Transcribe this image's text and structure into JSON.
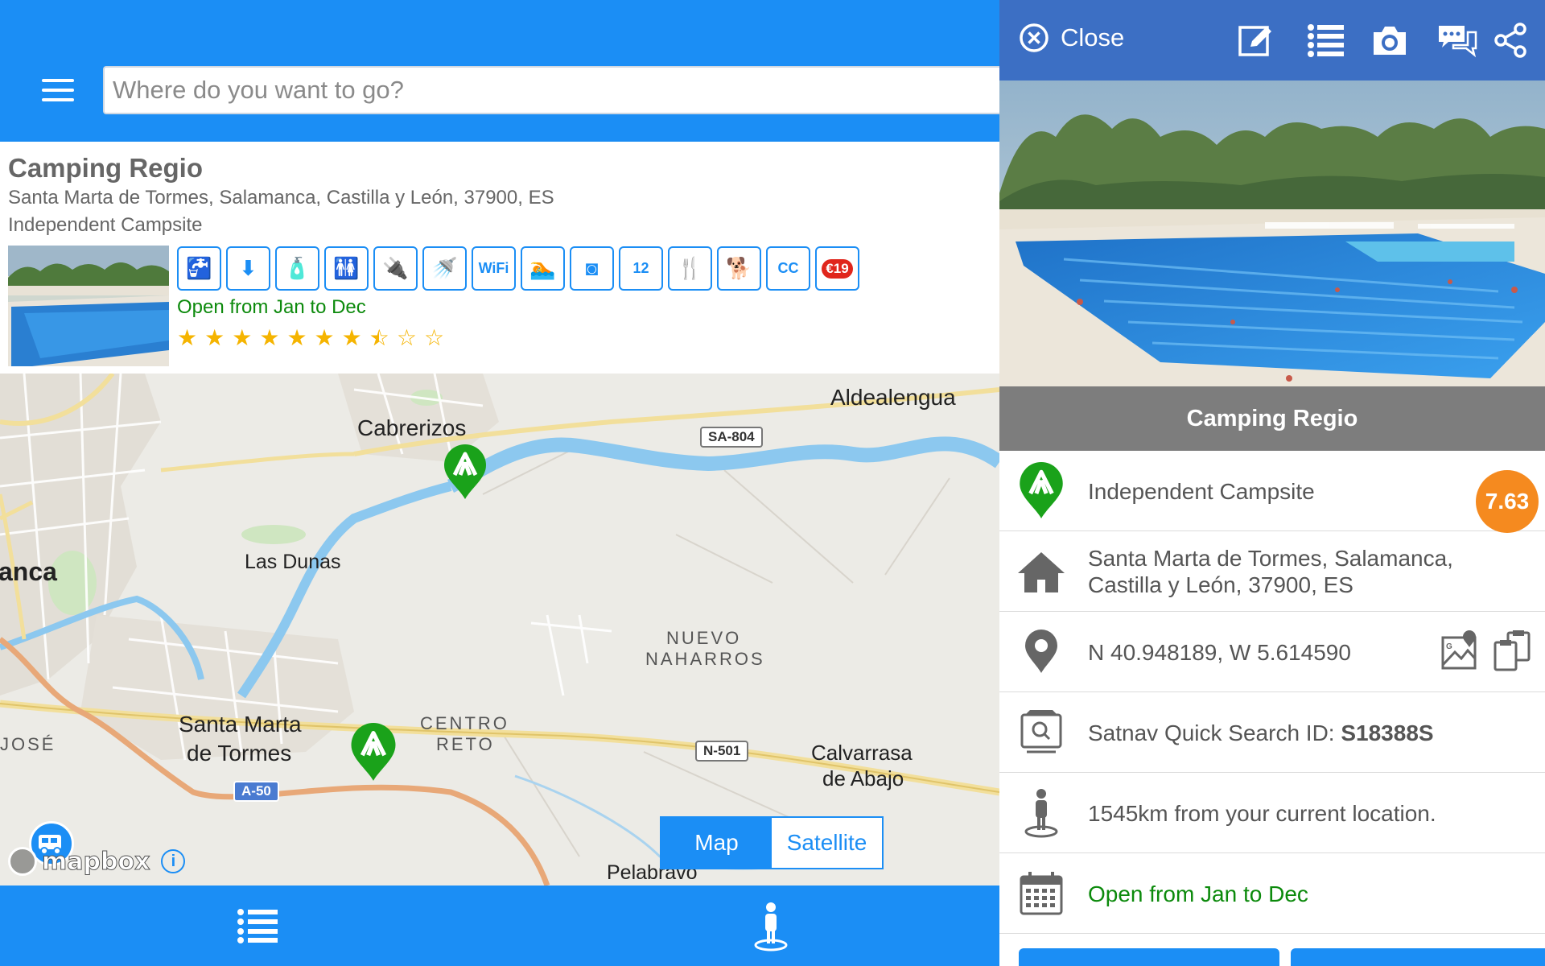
{
  "search": {
    "placeholder": "Where do you want to go?"
  },
  "card": {
    "title": "Camping Regio",
    "address": "Santa Marta de Tormes, Salamanca, Castilla y León, 37900, ES",
    "type": "Independent Campsite",
    "open": "Open from Jan to Dec",
    "rating": 7.5,
    "rating_max": 10,
    "amenities": [
      {
        "icon": "water-tap-icon",
        "glyph": "🚰"
      },
      {
        "icon": "waste-water-icon",
        "glyph": "⬇"
      },
      {
        "icon": "chemical-toilet-icon",
        "glyph": "🧴"
      },
      {
        "icon": "toilets-icon",
        "glyph": "🚻"
      },
      {
        "icon": "electric-hookup-icon",
        "glyph": "🔌"
      },
      {
        "icon": "shower-icon",
        "glyph": "🚿"
      },
      {
        "icon": "wifi-icon",
        "glyph": "WiFi"
      },
      {
        "icon": "swimming-icon",
        "glyph": "🏊"
      },
      {
        "icon": "laundry-icon",
        "glyph": "◙"
      },
      {
        "icon": "calendar-12-icon",
        "glyph": "12"
      },
      {
        "icon": "restaurant-icon",
        "glyph": "🍴"
      },
      {
        "icon": "dogs-allowed-icon",
        "glyph": "🐕"
      },
      {
        "icon": "acsi-icon",
        "glyph": "CC"
      },
      {
        "icon": "price-badge-icon",
        "glyph": "€19"
      }
    ]
  },
  "map": {
    "labels": [
      "Aldealengua",
      "Cabrerizos",
      "Las Dunas",
      "anca",
      "NUEVO",
      "NAHARROS",
      "Santa Marta",
      "de Tormes",
      "CENTRO",
      "RETO",
      "JOSÉ",
      "Calvarrasa",
      "de Abajo",
      "Pelabravo"
    ],
    "roads": [
      "SA-804",
      "N-501",
      "A-50"
    ],
    "toggle": {
      "map": "Map",
      "satellite": "Satellite",
      "active": "map"
    },
    "attribution": "mapbox"
  },
  "panel": {
    "close_label": "Close",
    "title": "Camping Regio",
    "rows": {
      "type": "Independent Campsite",
      "score": "7.63",
      "address": "Santa Marta de Tormes, Salamanca, Castilla y León, 37900, ES",
      "coords": "N 40.948189, W 5.614590",
      "satnav_prefix": "Satnav Quick Search ID: ",
      "satnav_id": "S18388S",
      "distance": "1545km from your current location.",
      "open": "Open from Jan to Dec"
    }
  },
  "colors": {
    "primary": "#1b8ef5",
    "panel_toolbar": "#3c6fc4",
    "green": "#1aa21a",
    "orange": "#f58a1f",
    "open_green": "#0c8a0c"
  }
}
